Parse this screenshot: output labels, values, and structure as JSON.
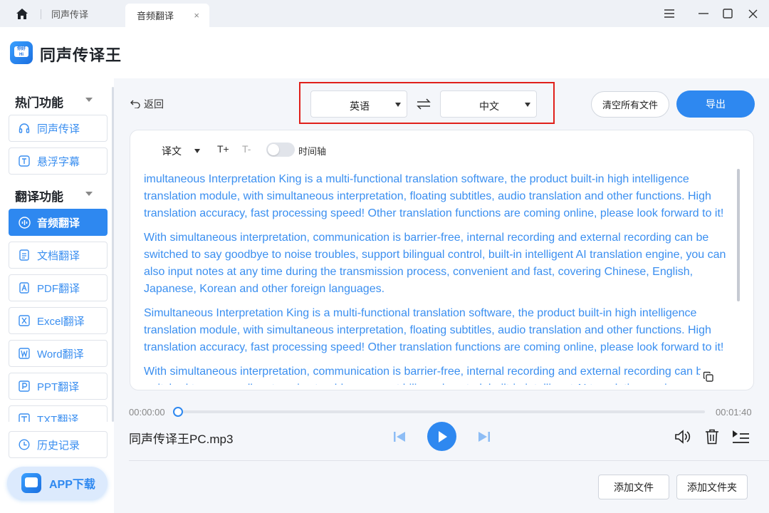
{
  "tabs": [
    {
      "label": "同声传译"
    },
    {
      "label": "音频翻译",
      "close": "×"
    }
  ],
  "app": {
    "title": "同声传译王",
    "logo_text": "你好\nHi"
  },
  "sidebar": {
    "sections": [
      {
        "title": "热门功能"
      },
      {
        "title": "翻译功能"
      }
    ],
    "items": [
      {
        "label": "同声传译",
        "icon": "headset-icon"
      },
      {
        "label": "悬浮字幕",
        "icon": "text-box-icon"
      },
      {
        "label": "音频翻译",
        "icon": "audio-wave-icon",
        "active": true
      },
      {
        "label": "文档翻译",
        "icon": "document-icon"
      },
      {
        "label": "PDF翻译",
        "icon": "pdf-icon"
      },
      {
        "label": "Excel翻译",
        "icon": "excel-icon"
      },
      {
        "label": "Word翻译",
        "icon": "word-icon"
      },
      {
        "label": "PPT翻译",
        "icon": "ppt-icon"
      },
      {
        "label": "TXT翻译",
        "icon": "txt-icon"
      },
      {
        "label": "历史记录",
        "icon": "clock-icon"
      }
    ],
    "app_download": "APP下载"
  },
  "toolbar": {
    "back_label": "返回",
    "source_lang": "英语",
    "target_lang": "中文",
    "clear_all_label": "清空所有文件",
    "export_label": "导出"
  },
  "panel": {
    "view_mode": "译文",
    "font_increase": "T+",
    "font_decrease": "T-",
    "timeline_label": "时间轴",
    "timeline_on": false,
    "paragraphs": [
      "imultaneous Interpretation King is a multi-functional translation software, the product built-in high intelligence translation module, with simultaneous interpretation, floating subtitles, audio translation and other functions. High translation accuracy, fast processing speed! Other translation functions are coming online, please look forward to it!",
      "With simultaneous interpretation, communication is barrier-free, internal recording and external recording can be switched to say goodbye to noise troubles, support bilingual control, built-in intelligent AI translation engine, you can also input notes at any time during the transmission process, convenient and fast, covering Chinese, English, Japanese, Korean and other foreign languages.",
      "Simultaneous Interpretation King is a multi-functional translation software, the product built-in high intelligence translation module, with simultaneous interpretation, floating subtitles, audio translation and other functions. High translation accuracy, fast processing speed! Other translation functions are coming online, please look forward to it!",
      "With simultaneous interpretation, communication is barrier-free, internal recording and external recording can be switched to say goodbye to noise troubles, support bilingual control, built-in intelligent AI translation engine."
    ]
  },
  "player": {
    "current_time": "00:00:00",
    "total_time": "00:01:40",
    "progress": 0,
    "file_name": "同声传译王PC.mp3"
  },
  "footer": {
    "add_file_label": "添加文件",
    "add_folder_label": "添加文件夹"
  },
  "colors": {
    "accent": "#2e88f0",
    "text_blue": "#3b8ff0",
    "highlight_border": "#e0201b"
  }
}
